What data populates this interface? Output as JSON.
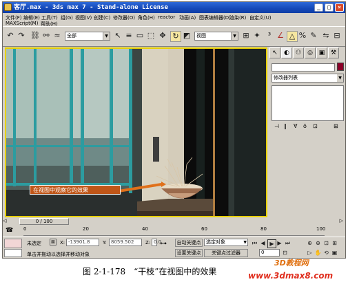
{
  "window": {
    "title": "客厅.max - 3ds max 7 - Stand-alone License",
    "min_glyph": "_",
    "max_glyph": "□",
    "close_glyph": "×"
  },
  "menu": {
    "row1": [
      "文件(F)",
      "编辑(E)",
      "工具(T)",
      "组(G)",
      "视图(V)",
      "创建(C)",
      "修改器(O)",
      "角色(H)",
      "reactor",
      "动画(A)",
      "图表编辑器(D)",
      "渲染(R)",
      "自定义(U)"
    ],
    "row2": [
      "MAXScript(M)",
      "帮助(H)"
    ]
  },
  "toolbar": {
    "selection_filter": "全部",
    "ref_coord": "视图"
  },
  "viewport": {
    "callout": "在视图中观察它的效果"
  },
  "command_panel": {
    "modifier_list": "修改器列表",
    "object_color": "#8b0028"
  },
  "timeline": {
    "slider": "0 / 100",
    "ticks": [
      "0",
      "20",
      "40",
      "60",
      "80",
      "100"
    ]
  },
  "status": {
    "selection": "未选定",
    "x_label": "X:",
    "x_value": "-13901.8",
    "y_label": "Y:",
    "y_value": "8059.502",
    "z_label": "Z:",
    "z_value": "0.0",
    "prompt": "单击并拖动以选择并移动对象",
    "auto_key": "自动关键点",
    "set_key": "设置关键点",
    "selected_object": "选定对象",
    "key_filters": "关键点过滤器",
    "frame": "0"
  },
  "caption": "图 2-1-178　“干枝”在视图中的效果",
  "watermark": {
    "site_name": "3D教程网",
    "url": "www.3dmax8.com"
  }
}
